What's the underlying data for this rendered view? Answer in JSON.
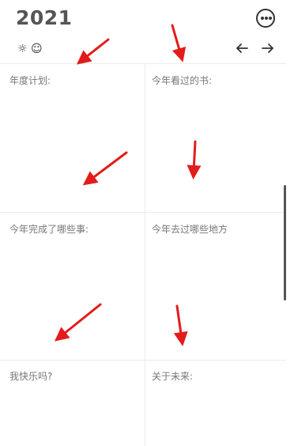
{
  "header": {
    "year": "2021",
    "more_icon": "more-horizontal-circle-icon"
  },
  "toolbar": {
    "icons": [
      "sun-icon",
      "smiley-icon"
    ],
    "sun_glyph": "☼",
    "smile_glyph": "☺",
    "prev_icon": "arrow-left-icon",
    "next_icon": "arrow-right-icon"
  },
  "cells": [
    {
      "label": "年度计划:"
    },
    {
      "label": "今年看过的书:"
    },
    {
      "label": "今年完成了哪些事:"
    },
    {
      "label": "今年去过哪些地方"
    },
    {
      "label": "我快乐吗?"
    },
    {
      "label": "关于未来:"
    }
  ],
  "annotation_arrows": {
    "count": 6,
    "color": "#e31b1b"
  }
}
